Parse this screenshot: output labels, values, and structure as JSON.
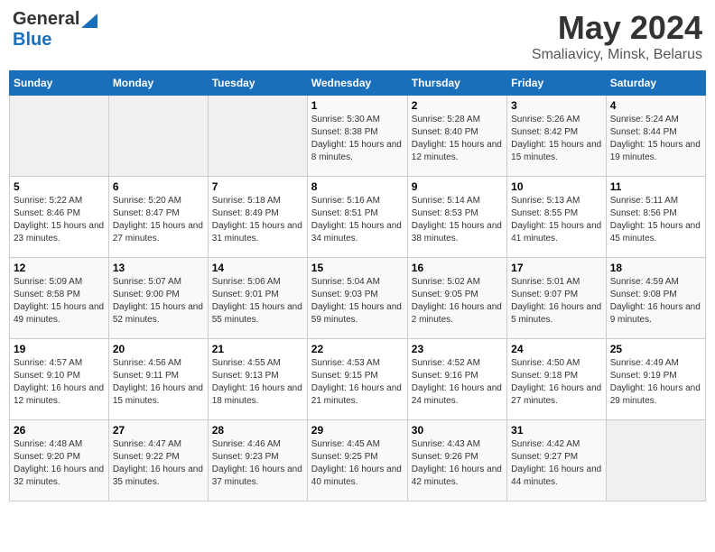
{
  "header": {
    "logo_general": "General",
    "logo_blue": "Blue",
    "title": "May 2024",
    "location": "Smaliavicy, Minsk, Belarus"
  },
  "days_of_week": [
    "Sunday",
    "Monday",
    "Tuesday",
    "Wednesday",
    "Thursday",
    "Friday",
    "Saturday"
  ],
  "weeks": [
    [
      {
        "day": "",
        "info": ""
      },
      {
        "day": "",
        "info": ""
      },
      {
        "day": "",
        "info": ""
      },
      {
        "day": "1",
        "info": "Sunrise: 5:30 AM\nSunset: 8:38 PM\nDaylight: 15 hours\nand 8 minutes."
      },
      {
        "day": "2",
        "info": "Sunrise: 5:28 AM\nSunset: 8:40 PM\nDaylight: 15 hours\nand 12 minutes."
      },
      {
        "day": "3",
        "info": "Sunrise: 5:26 AM\nSunset: 8:42 PM\nDaylight: 15 hours\nand 15 minutes."
      },
      {
        "day": "4",
        "info": "Sunrise: 5:24 AM\nSunset: 8:44 PM\nDaylight: 15 hours\nand 19 minutes."
      }
    ],
    [
      {
        "day": "5",
        "info": "Sunrise: 5:22 AM\nSunset: 8:46 PM\nDaylight: 15 hours\nand 23 minutes."
      },
      {
        "day": "6",
        "info": "Sunrise: 5:20 AM\nSunset: 8:47 PM\nDaylight: 15 hours\nand 27 minutes."
      },
      {
        "day": "7",
        "info": "Sunrise: 5:18 AM\nSunset: 8:49 PM\nDaylight: 15 hours\nand 31 minutes."
      },
      {
        "day": "8",
        "info": "Sunrise: 5:16 AM\nSunset: 8:51 PM\nDaylight: 15 hours\nand 34 minutes."
      },
      {
        "day": "9",
        "info": "Sunrise: 5:14 AM\nSunset: 8:53 PM\nDaylight: 15 hours\nand 38 minutes."
      },
      {
        "day": "10",
        "info": "Sunrise: 5:13 AM\nSunset: 8:55 PM\nDaylight: 15 hours\nand 41 minutes."
      },
      {
        "day": "11",
        "info": "Sunrise: 5:11 AM\nSunset: 8:56 PM\nDaylight: 15 hours\nand 45 minutes."
      }
    ],
    [
      {
        "day": "12",
        "info": "Sunrise: 5:09 AM\nSunset: 8:58 PM\nDaylight: 15 hours\nand 49 minutes."
      },
      {
        "day": "13",
        "info": "Sunrise: 5:07 AM\nSunset: 9:00 PM\nDaylight: 15 hours\nand 52 minutes."
      },
      {
        "day": "14",
        "info": "Sunrise: 5:06 AM\nSunset: 9:01 PM\nDaylight: 15 hours\nand 55 minutes."
      },
      {
        "day": "15",
        "info": "Sunrise: 5:04 AM\nSunset: 9:03 PM\nDaylight: 15 hours\nand 59 minutes."
      },
      {
        "day": "16",
        "info": "Sunrise: 5:02 AM\nSunset: 9:05 PM\nDaylight: 16 hours\nand 2 minutes."
      },
      {
        "day": "17",
        "info": "Sunrise: 5:01 AM\nSunset: 9:07 PM\nDaylight: 16 hours\nand 5 minutes."
      },
      {
        "day": "18",
        "info": "Sunrise: 4:59 AM\nSunset: 9:08 PM\nDaylight: 16 hours\nand 9 minutes."
      }
    ],
    [
      {
        "day": "19",
        "info": "Sunrise: 4:57 AM\nSunset: 9:10 PM\nDaylight: 16 hours\nand 12 minutes."
      },
      {
        "day": "20",
        "info": "Sunrise: 4:56 AM\nSunset: 9:11 PM\nDaylight: 16 hours\nand 15 minutes."
      },
      {
        "day": "21",
        "info": "Sunrise: 4:55 AM\nSunset: 9:13 PM\nDaylight: 16 hours\nand 18 minutes."
      },
      {
        "day": "22",
        "info": "Sunrise: 4:53 AM\nSunset: 9:15 PM\nDaylight: 16 hours\nand 21 minutes."
      },
      {
        "day": "23",
        "info": "Sunrise: 4:52 AM\nSunset: 9:16 PM\nDaylight: 16 hours\nand 24 minutes."
      },
      {
        "day": "24",
        "info": "Sunrise: 4:50 AM\nSunset: 9:18 PM\nDaylight: 16 hours\nand 27 minutes."
      },
      {
        "day": "25",
        "info": "Sunrise: 4:49 AM\nSunset: 9:19 PM\nDaylight: 16 hours\nand 29 minutes."
      }
    ],
    [
      {
        "day": "26",
        "info": "Sunrise: 4:48 AM\nSunset: 9:20 PM\nDaylight: 16 hours\nand 32 minutes."
      },
      {
        "day": "27",
        "info": "Sunrise: 4:47 AM\nSunset: 9:22 PM\nDaylight: 16 hours\nand 35 minutes."
      },
      {
        "day": "28",
        "info": "Sunrise: 4:46 AM\nSunset: 9:23 PM\nDaylight: 16 hours\nand 37 minutes."
      },
      {
        "day": "29",
        "info": "Sunrise: 4:45 AM\nSunset: 9:25 PM\nDaylight: 16 hours\nand 40 minutes."
      },
      {
        "day": "30",
        "info": "Sunrise: 4:43 AM\nSunset: 9:26 PM\nDaylight: 16 hours\nand 42 minutes."
      },
      {
        "day": "31",
        "info": "Sunrise: 4:42 AM\nSunset: 9:27 PM\nDaylight: 16 hours\nand 44 minutes."
      },
      {
        "day": "",
        "info": ""
      }
    ]
  ]
}
